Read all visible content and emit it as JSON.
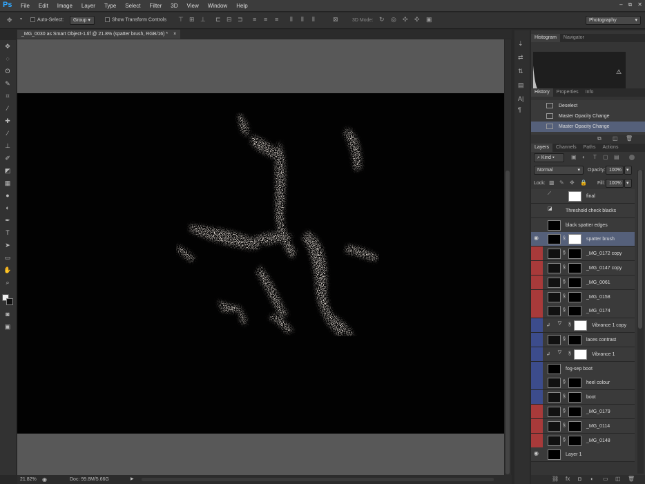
{
  "app": {
    "logo": "Ps"
  },
  "menubar": {
    "items": [
      "File",
      "Edit",
      "Image",
      "Layer",
      "Type",
      "Select",
      "Filter",
      "3D",
      "View",
      "Window",
      "Help"
    ],
    "window_controls": [
      "–",
      "⧉",
      "✕"
    ]
  },
  "options": {
    "auto_select_label": "Auto-Select:",
    "auto_select_value": "Group",
    "show_transform_label": "Show Transform Controls",
    "mode_3d_label": "3D Mode:",
    "workspace": "Photography"
  },
  "document": {
    "tab_title": "_MG_0030 as Smart Object-1.tif @ 21.8% (spatter brush, RGB/16) *",
    "close_glyph": "×"
  },
  "status": {
    "zoom": "21.82%",
    "doc_info": "Doc: 99.8M/5.66G"
  },
  "panels": {
    "top_tabs": [
      "Histogram",
      "Navigator"
    ],
    "history_tabs": [
      "History",
      "Properties",
      "Info"
    ],
    "layers_tabs": [
      "Layers",
      "Channels",
      "Paths",
      "Actions"
    ]
  },
  "history": {
    "items": [
      {
        "label": "Deselect",
        "selected": false
      },
      {
        "label": "Master Opacity Change",
        "selected": false
      },
      {
        "label": "Master Opacity Change",
        "selected": true
      }
    ]
  },
  "layers_panel": {
    "filter_kind": "Kind",
    "blend_mode": "Normal",
    "opacity_label": "Opacity:",
    "opacity_value": "100%",
    "lock_label": "Lock:",
    "fill_label": "Fill:",
    "fill_value": "100%"
  },
  "colors": {
    "red_tag": "#a83a3a",
    "blue_tag": "#3c4c8c",
    "selected": "#55607a"
  },
  "layers": [
    {
      "name": "final",
      "visible": false,
      "tag": "none",
      "kind": "adjust",
      "selected": false
    },
    {
      "name": "Threshold check blacks",
      "visible": false,
      "tag": "none",
      "kind": "threshold",
      "selected": false
    },
    {
      "name": "black spatter edges",
      "visible": false,
      "tag": "none",
      "kind": "checker",
      "selected": false
    },
    {
      "name": "spatter brush",
      "visible": true,
      "tag": "none",
      "kind": "checker-mask",
      "selected": true
    },
    {
      "name": "_MG_0172 copy",
      "visible": false,
      "tag": "red",
      "kind": "smart",
      "selected": false
    },
    {
      "name": "_MG_0147 copy",
      "visible": false,
      "tag": "red",
      "kind": "smart",
      "selected": false
    },
    {
      "name": "_MG_0061",
      "visible": false,
      "tag": "red",
      "kind": "smart",
      "selected": false
    },
    {
      "name": "_MG_0158",
      "visible": false,
      "tag": "red",
      "kind": "smart",
      "selected": false
    },
    {
      "name": "_MG_0174",
      "visible": false,
      "tag": "red",
      "kind": "smart",
      "selected": false
    },
    {
      "name": "Vibrance 1 copy",
      "visible": false,
      "tag": "blue",
      "kind": "vibrance",
      "selected": false
    },
    {
      "name": "laces contrast",
      "visible": false,
      "tag": "blue",
      "kind": "smart",
      "selected": false
    },
    {
      "name": "Vibrance 1",
      "visible": false,
      "tag": "blue",
      "kind": "vibrance",
      "selected": false
    },
    {
      "name": "fog-sep boot",
      "visible": false,
      "tag": "blue",
      "kind": "checker",
      "selected": false
    },
    {
      "name": "heel colour",
      "visible": false,
      "tag": "blue",
      "kind": "smart",
      "selected": false
    },
    {
      "name": "boot",
      "visible": false,
      "tag": "blue",
      "kind": "smart",
      "selected": false
    },
    {
      "name": "_MG_0179",
      "visible": false,
      "tag": "red",
      "kind": "smart",
      "selected": false
    },
    {
      "name": "_MG_0114",
      "visible": false,
      "tag": "red",
      "kind": "smart",
      "selected": false
    },
    {
      "name": "_MG_0148",
      "visible": false,
      "tag": "red",
      "kind": "smart",
      "selected": false
    },
    {
      "name": "Layer 1",
      "visible": true,
      "tag": "none",
      "kind": "black",
      "selected": false
    }
  ]
}
